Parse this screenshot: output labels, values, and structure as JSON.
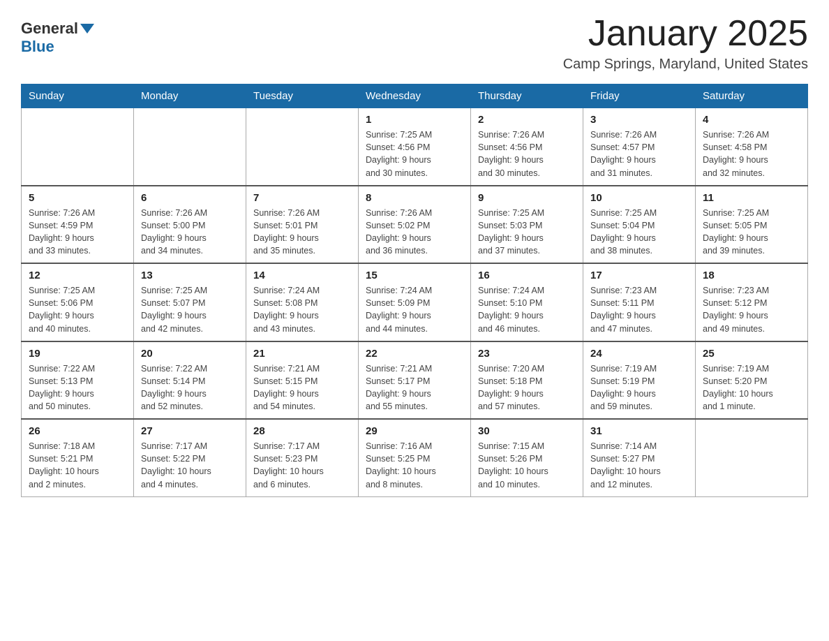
{
  "header": {
    "logo_general": "General",
    "logo_blue": "Blue",
    "title": "January 2025",
    "subtitle": "Camp Springs, Maryland, United States"
  },
  "days_of_week": [
    "Sunday",
    "Monday",
    "Tuesday",
    "Wednesday",
    "Thursday",
    "Friday",
    "Saturday"
  ],
  "weeks": [
    [
      {
        "day": "",
        "info": ""
      },
      {
        "day": "",
        "info": ""
      },
      {
        "day": "",
        "info": ""
      },
      {
        "day": "1",
        "info": "Sunrise: 7:25 AM\nSunset: 4:56 PM\nDaylight: 9 hours\nand 30 minutes."
      },
      {
        "day": "2",
        "info": "Sunrise: 7:26 AM\nSunset: 4:56 PM\nDaylight: 9 hours\nand 30 minutes."
      },
      {
        "day": "3",
        "info": "Sunrise: 7:26 AM\nSunset: 4:57 PM\nDaylight: 9 hours\nand 31 minutes."
      },
      {
        "day": "4",
        "info": "Sunrise: 7:26 AM\nSunset: 4:58 PM\nDaylight: 9 hours\nand 32 minutes."
      }
    ],
    [
      {
        "day": "5",
        "info": "Sunrise: 7:26 AM\nSunset: 4:59 PM\nDaylight: 9 hours\nand 33 minutes."
      },
      {
        "day": "6",
        "info": "Sunrise: 7:26 AM\nSunset: 5:00 PM\nDaylight: 9 hours\nand 34 minutes."
      },
      {
        "day": "7",
        "info": "Sunrise: 7:26 AM\nSunset: 5:01 PM\nDaylight: 9 hours\nand 35 minutes."
      },
      {
        "day": "8",
        "info": "Sunrise: 7:26 AM\nSunset: 5:02 PM\nDaylight: 9 hours\nand 36 minutes."
      },
      {
        "day": "9",
        "info": "Sunrise: 7:25 AM\nSunset: 5:03 PM\nDaylight: 9 hours\nand 37 minutes."
      },
      {
        "day": "10",
        "info": "Sunrise: 7:25 AM\nSunset: 5:04 PM\nDaylight: 9 hours\nand 38 minutes."
      },
      {
        "day": "11",
        "info": "Sunrise: 7:25 AM\nSunset: 5:05 PM\nDaylight: 9 hours\nand 39 minutes."
      }
    ],
    [
      {
        "day": "12",
        "info": "Sunrise: 7:25 AM\nSunset: 5:06 PM\nDaylight: 9 hours\nand 40 minutes."
      },
      {
        "day": "13",
        "info": "Sunrise: 7:25 AM\nSunset: 5:07 PM\nDaylight: 9 hours\nand 42 minutes."
      },
      {
        "day": "14",
        "info": "Sunrise: 7:24 AM\nSunset: 5:08 PM\nDaylight: 9 hours\nand 43 minutes."
      },
      {
        "day": "15",
        "info": "Sunrise: 7:24 AM\nSunset: 5:09 PM\nDaylight: 9 hours\nand 44 minutes."
      },
      {
        "day": "16",
        "info": "Sunrise: 7:24 AM\nSunset: 5:10 PM\nDaylight: 9 hours\nand 46 minutes."
      },
      {
        "day": "17",
        "info": "Sunrise: 7:23 AM\nSunset: 5:11 PM\nDaylight: 9 hours\nand 47 minutes."
      },
      {
        "day": "18",
        "info": "Sunrise: 7:23 AM\nSunset: 5:12 PM\nDaylight: 9 hours\nand 49 minutes."
      }
    ],
    [
      {
        "day": "19",
        "info": "Sunrise: 7:22 AM\nSunset: 5:13 PM\nDaylight: 9 hours\nand 50 minutes."
      },
      {
        "day": "20",
        "info": "Sunrise: 7:22 AM\nSunset: 5:14 PM\nDaylight: 9 hours\nand 52 minutes."
      },
      {
        "day": "21",
        "info": "Sunrise: 7:21 AM\nSunset: 5:15 PM\nDaylight: 9 hours\nand 54 minutes."
      },
      {
        "day": "22",
        "info": "Sunrise: 7:21 AM\nSunset: 5:17 PM\nDaylight: 9 hours\nand 55 minutes."
      },
      {
        "day": "23",
        "info": "Sunrise: 7:20 AM\nSunset: 5:18 PM\nDaylight: 9 hours\nand 57 minutes."
      },
      {
        "day": "24",
        "info": "Sunrise: 7:19 AM\nSunset: 5:19 PM\nDaylight: 9 hours\nand 59 minutes."
      },
      {
        "day": "25",
        "info": "Sunrise: 7:19 AM\nSunset: 5:20 PM\nDaylight: 10 hours\nand 1 minute."
      }
    ],
    [
      {
        "day": "26",
        "info": "Sunrise: 7:18 AM\nSunset: 5:21 PM\nDaylight: 10 hours\nand 2 minutes."
      },
      {
        "day": "27",
        "info": "Sunrise: 7:17 AM\nSunset: 5:22 PM\nDaylight: 10 hours\nand 4 minutes."
      },
      {
        "day": "28",
        "info": "Sunrise: 7:17 AM\nSunset: 5:23 PM\nDaylight: 10 hours\nand 6 minutes."
      },
      {
        "day": "29",
        "info": "Sunrise: 7:16 AM\nSunset: 5:25 PM\nDaylight: 10 hours\nand 8 minutes."
      },
      {
        "day": "30",
        "info": "Sunrise: 7:15 AM\nSunset: 5:26 PM\nDaylight: 10 hours\nand 10 minutes."
      },
      {
        "day": "31",
        "info": "Sunrise: 7:14 AM\nSunset: 5:27 PM\nDaylight: 10 hours\nand 12 minutes."
      },
      {
        "day": "",
        "info": ""
      }
    ]
  ]
}
